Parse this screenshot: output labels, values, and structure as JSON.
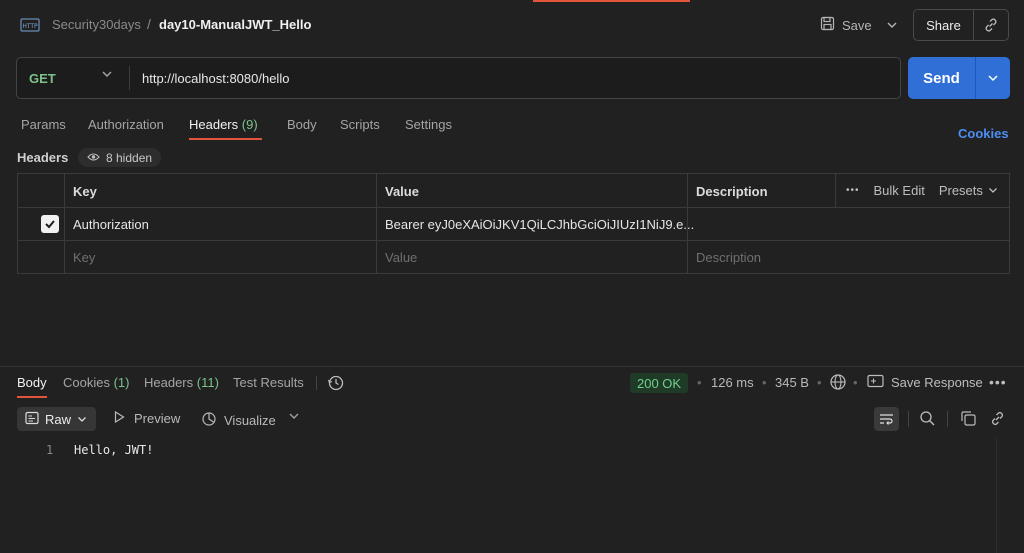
{
  "breadcrumb": {
    "parent": "Security30days",
    "separator": "/",
    "current": "day10-ManualJWT_Hello",
    "icon": "http-icon"
  },
  "header_actions": {
    "save_label": "Save",
    "share_label": "Share"
  },
  "request": {
    "method": "GET",
    "url": "http://localhost:8080/hello",
    "send_label": "Send"
  },
  "request_tabs": [
    {
      "label": "Params"
    },
    {
      "label": "Authorization"
    },
    {
      "label": "Headers",
      "count": "(9)",
      "active": true
    },
    {
      "label": "Body"
    },
    {
      "label": "Scripts"
    },
    {
      "label": "Settings"
    }
  ],
  "cookies_link": "Cookies",
  "headers_section": {
    "title": "Headers",
    "hidden_label": "8 hidden"
  },
  "headers_table": {
    "columns": {
      "key": "Key",
      "value": "Value",
      "description": "Description"
    },
    "tools": {
      "bulk_edit": "Bulk Edit",
      "presets": "Presets"
    },
    "rows": [
      {
        "checked": true,
        "key": "Authorization",
        "value": "Bearer eyJ0eXAiOiJKV1QiLCJhbGciOiJIUzI1NiJ9.e...",
        "description": ""
      }
    ],
    "placeholder": {
      "key": "Key",
      "value": "Value",
      "description": "Description"
    }
  },
  "response_tabs": {
    "body": "Body",
    "cookies": "Cookies",
    "cookies_count": "(1)",
    "headers": "Headers",
    "headers_count": "(11)",
    "test_results": "Test Results"
  },
  "response_meta": {
    "status": "200 OK",
    "time": "126 ms",
    "size": "345 B",
    "save_response": "Save Response"
  },
  "body_view": {
    "raw": "Raw",
    "preview": "Preview",
    "visualize": "Visualize"
  },
  "response_body": {
    "lines": [
      {
        "number": "1",
        "text": "Hello, JWT!"
      }
    ]
  },
  "colors": {
    "accent": "#e2553a",
    "send": "#2f6fd6",
    "method_get": "#7cc38b",
    "link": "#4d8ef2",
    "background": "#212121"
  }
}
